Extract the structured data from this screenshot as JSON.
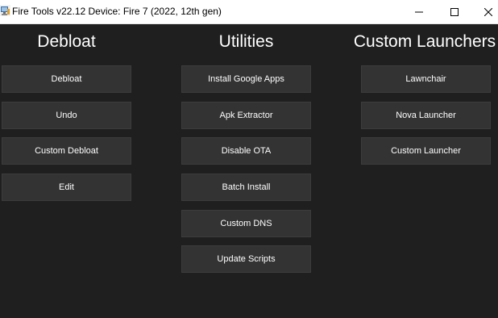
{
  "window": {
    "title": "Fire Tools v22.12 Device: Fire 7 (2022, 12th gen)"
  },
  "columns": {
    "debloat": {
      "title": "Debloat",
      "buttons": [
        "Debloat",
        "Undo",
        "Custom Debloat",
        "Edit"
      ]
    },
    "utilities": {
      "title": "Utilities",
      "buttons": [
        "Install Google Apps",
        "Apk Extractor",
        "Disable OTA",
        "Batch Install",
        "Custom DNS",
        "Update Scripts"
      ]
    },
    "launchers": {
      "title": "Custom Launchers",
      "buttons": [
        "Lawnchair",
        "Nova Launcher",
        "Custom Launcher"
      ]
    }
  },
  "colors": {
    "background": "#1f1f1f",
    "button": "#333333",
    "text": "#ffffff",
    "titlebar": "#ffffff"
  },
  "icons": {
    "app": "app-icon",
    "minimize": "minimize-icon",
    "maximize": "maximize-icon",
    "close": "close-icon"
  }
}
